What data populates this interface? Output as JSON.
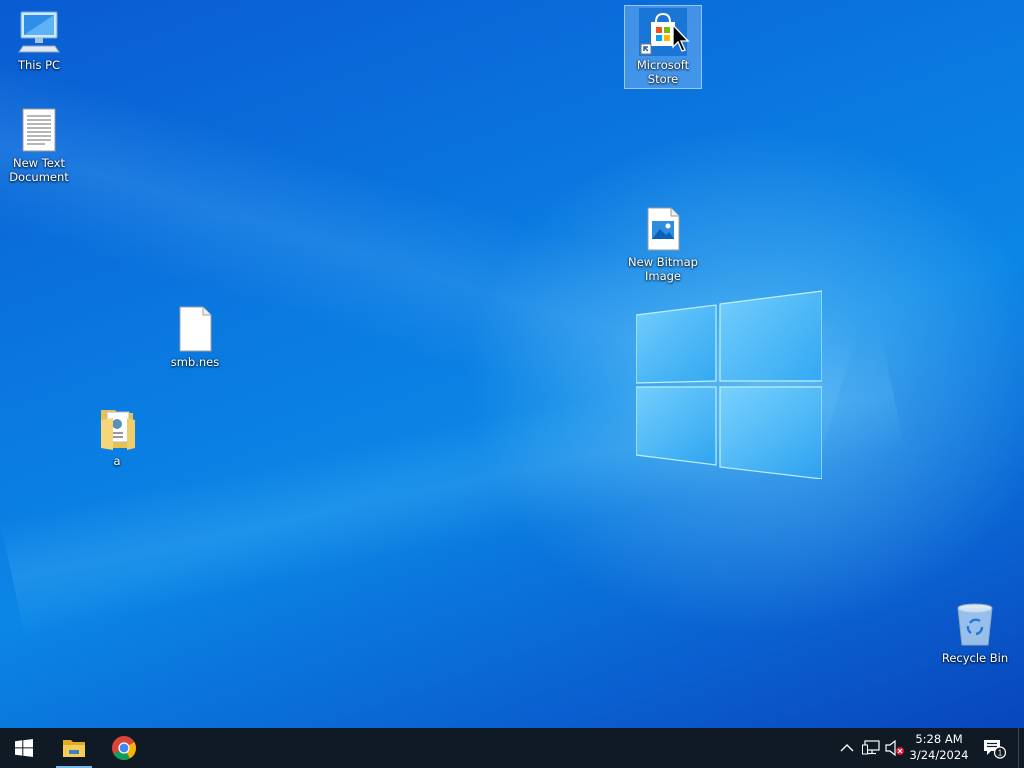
{
  "desktop": {
    "icons": [
      {
        "id": "this-pc",
        "label": "This PC",
        "icon": "computer-icon"
      },
      {
        "id": "new-text-document",
        "label": "New Text\nDocument",
        "icon": "text-document-icon"
      },
      {
        "id": "microsoft-store",
        "label": "Microsoft\nStore",
        "icon": "store-icon",
        "selected": true
      },
      {
        "id": "new-bitmap-image",
        "label": "New Bitmap\nImage",
        "icon": "bitmap-image-icon"
      },
      {
        "id": "smb-nes",
        "label": "smb.nes",
        "icon": "blank-file-icon"
      },
      {
        "id": "a",
        "label": "a",
        "icon": "folder-icon"
      },
      {
        "id": "recycle-bin",
        "label": "Recycle Bin",
        "icon": "recycle-bin-icon"
      }
    ]
  },
  "taskbar": {
    "start_icon": "windows-start-icon",
    "pinned": [
      {
        "name": "File Explorer",
        "icon": "file-explorer-icon",
        "active": true
      },
      {
        "name": "Google Chrome",
        "icon": "chrome-icon",
        "active": false
      }
    ],
    "tray": {
      "overflow_icon": "chevron-up-icon",
      "network_icon": "network-icon",
      "volume_icon": "volume-muted-icon",
      "time": "5:28 AM",
      "date": "3/24/2024",
      "notification_count": "1"
    }
  },
  "colors": {
    "taskbar": "#101a24",
    "accent": "#76b9ed",
    "desktop_blue": "#0a78e0"
  }
}
